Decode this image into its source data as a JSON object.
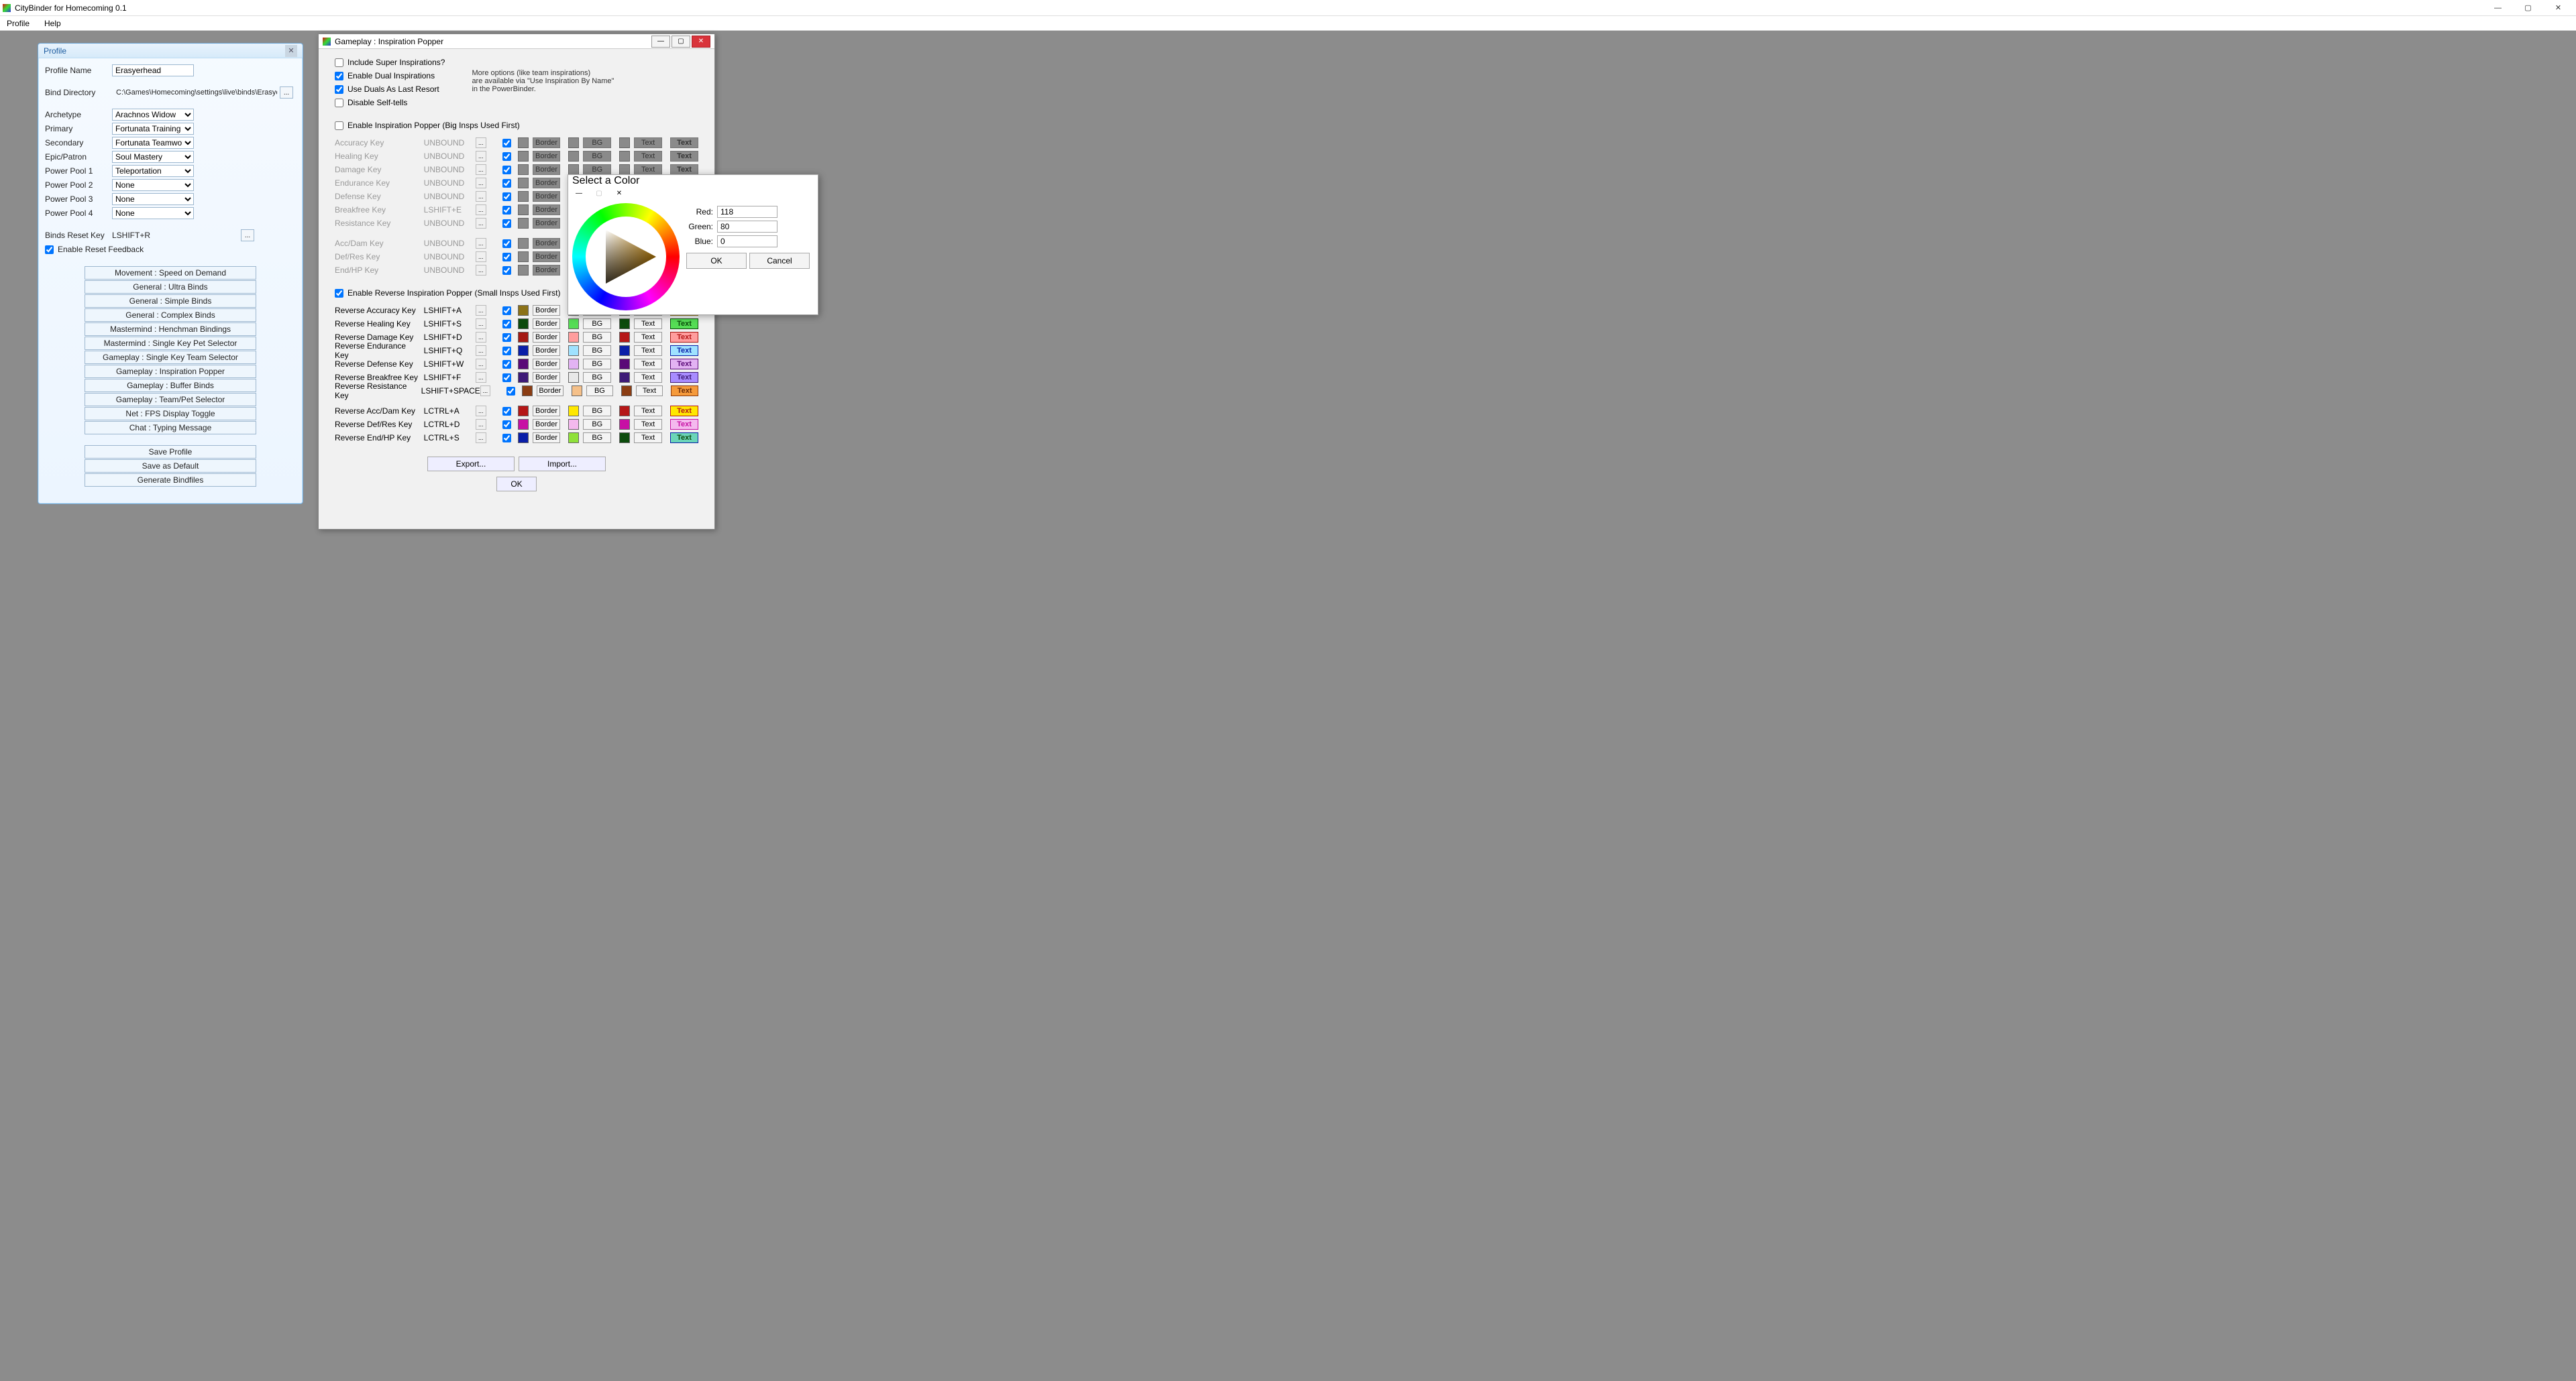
{
  "app": {
    "title": "CityBinder for Homecoming 0.1",
    "menu": [
      "Profile",
      "Help"
    ]
  },
  "profile_panel": {
    "title": "Profile",
    "name_label": "Profile Name",
    "name_value": "Erasyerhead",
    "binddir_label": "Bind Directory",
    "binddir_value": "C:\\Games\\Homecoming\\settings\\live\\binds\\Erasyer",
    "fields": [
      {
        "label": "Archetype",
        "value": "Arachnos Widow"
      },
      {
        "label": "Primary",
        "value": "Fortunata Training"
      },
      {
        "label": "Secondary",
        "value": "Fortunata Teamwork"
      },
      {
        "label": "Epic/Patron",
        "value": "Soul Mastery"
      },
      {
        "label": "Power Pool 1",
        "value": "Teleportation"
      },
      {
        "label": "Power Pool 2",
        "value": "None"
      },
      {
        "label": "Power Pool 3",
        "value": "None"
      },
      {
        "label": "Power Pool 4",
        "value": "None"
      }
    ],
    "reset_label": "Binds Reset Key",
    "reset_value": "LSHIFT+R",
    "reset_feedback": "Enable Reset Feedback",
    "modules": [
      "Movement : Speed on Demand",
      "General : Ultra Binds",
      "General : Simple Binds",
      "General : Complex Binds",
      "Mastermind : Henchman Bindings",
      "Mastermind : Single Key Pet Selector",
      "Gameplay : Single Key Team Selector",
      "Gameplay : Inspiration Popper",
      "Gameplay : Buffer Binds",
      "Gameplay : Team/Pet Selector",
      "Net : FPS Display Toggle",
      "Chat : Typing Message"
    ],
    "actions": [
      "Save Profile",
      "Save as Default",
      "Generate Bindfiles"
    ]
  },
  "gameplay_dialog": {
    "title": "Gameplay : Inspiration Popper",
    "top_opts": [
      {
        "label": "Include Super Inspirations?",
        "checked": false
      },
      {
        "label": "Enable Dual Inspirations",
        "checked": true
      },
      {
        "label": "Use Duals As Last Resort",
        "checked": true
      },
      {
        "label": "Disable Self-tells",
        "checked": false
      }
    ],
    "hint": "More options (like team inspirations)\nare available via \"Use Inspiration By Name\"\nin the PowerBinder.",
    "enable_popper": "Enable Inspiration Popper (Big Insps Used First)",
    "popper_rows": [
      {
        "label": "Accuracy Key",
        "bind": "UNBOUND"
      },
      {
        "label": "Healing Key",
        "bind": "UNBOUND"
      },
      {
        "label": "Damage Key",
        "bind": "UNBOUND"
      },
      {
        "label": "Endurance Key",
        "bind": "UNBOUND"
      },
      {
        "label": "Defense Key",
        "bind": "UNBOUND"
      },
      {
        "label": "Breakfree Key",
        "bind": "LSHIFT+E"
      },
      {
        "label": "Resistance Key",
        "bind": "UNBOUND"
      }
    ],
    "popper_rows2": [
      {
        "label": "Acc/Dam Key",
        "bind": "UNBOUND"
      },
      {
        "label": "Def/Res Key",
        "bind": "UNBOUND"
      },
      {
        "label": "End/HP Key",
        "bind": "UNBOUND"
      }
    ],
    "enable_reverse": "Enable Reverse Inspiration Popper (Small Insps Used First)",
    "reverse_rows": [
      {
        "label": "Reverse Accuracy Key",
        "bind": "LSHIFT+A",
        "border": "#8c7218",
        "bg": "#ffe800",
        "txt": "#8c7218",
        "tagbg": "#ffe800",
        "tagfg": "#8c6f18"
      },
      {
        "label": "Reverse Healing Key",
        "bind": "LSHIFT+S",
        "border": "#0c4b0c",
        "bg": "#55dd55",
        "txt": "#0c4b0c",
        "tagbg": "#55dd55",
        "tagfg": "#0c4b0c"
      },
      {
        "label": "Reverse Damage Key",
        "bind": "LSHIFT+D",
        "border": "#a51914",
        "bg": "#ff9d9d",
        "txt": "#b51717",
        "tagbg": "#ff9d9d",
        "tagfg": "#b51717"
      },
      {
        "label": "Reverse Endurance Key",
        "bind": "LSHIFT+Q",
        "border": "#0a1ea8",
        "bg": "#9fe2ff",
        "txt": "#0a1ea8",
        "tagbg": "#9fe2ff",
        "tagfg": "#0a1ea8"
      },
      {
        "label": "Reverse Defense Key",
        "bind": "LSHIFT+W",
        "border": "#5a0977",
        "bg": "#e3b3f3",
        "txt": "#5a0977",
        "tagbg": "#e3b3f3",
        "tagfg": "#5a0977"
      },
      {
        "label": "Reverse Breakfree Key",
        "bind": "LSHIFT+F",
        "border": "#3e1a77",
        "bg": "#e8e8e8",
        "txt": "#3e1a77",
        "tagbg": "#a88cff",
        "tagfg": "#3e1a77"
      },
      {
        "label": "Reverse Resistance Key",
        "bind": "LSHIFT+SPACE",
        "border": "#8b3d13",
        "bg": "#f5c089",
        "txt": "#8b3d13",
        "tagbg": "#f59a3b",
        "tagfg": "#6b2d0a"
      }
    ],
    "reverse_rows2": [
      {
        "label": "Reverse Acc/Dam Key",
        "bind": "LCTRL+A",
        "border": "#b51717",
        "bg": "#ffe800",
        "txt": "#b51717",
        "tagbg": "#ffe800",
        "tagfg": "#b51717"
      },
      {
        "label": "Reverse Def/Res Key",
        "bind": "LCTRL+D",
        "border": "#c710a4",
        "bg": "#f4b9ee",
        "txt": "#c710a4",
        "tagbg": "#f4b9ee",
        "tagfg": "#c710a4"
      },
      {
        "label": "Reverse End/HP Key",
        "bind": "LCTRL+S",
        "border": "#0a1ea8",
        "bg": "#8fe13a",
        "txt": "#0c4b0c",
        "tagbg": "#6bd5b8",
        "tagfg": "#0c4b0c"
      }
    ],
    "border_label": "Border",
    "bg_label": "BG",
    "text_label": "Text",
    "tag_label": "Text",
    "export": "Export...",
    "import": "Import...",
    "ok": "OK"
  },
  "color_dialog": {
    "title": "Select a Color",
    "red_label": "Red:",
    "red_val": "118",
    "green_label": "Green:",
    "green_val": "80",
    "blue_label": "Blue:",
    "blue_val": "0",
    "ok": "OK",
    "cancel": "Cancel"
  }
}
